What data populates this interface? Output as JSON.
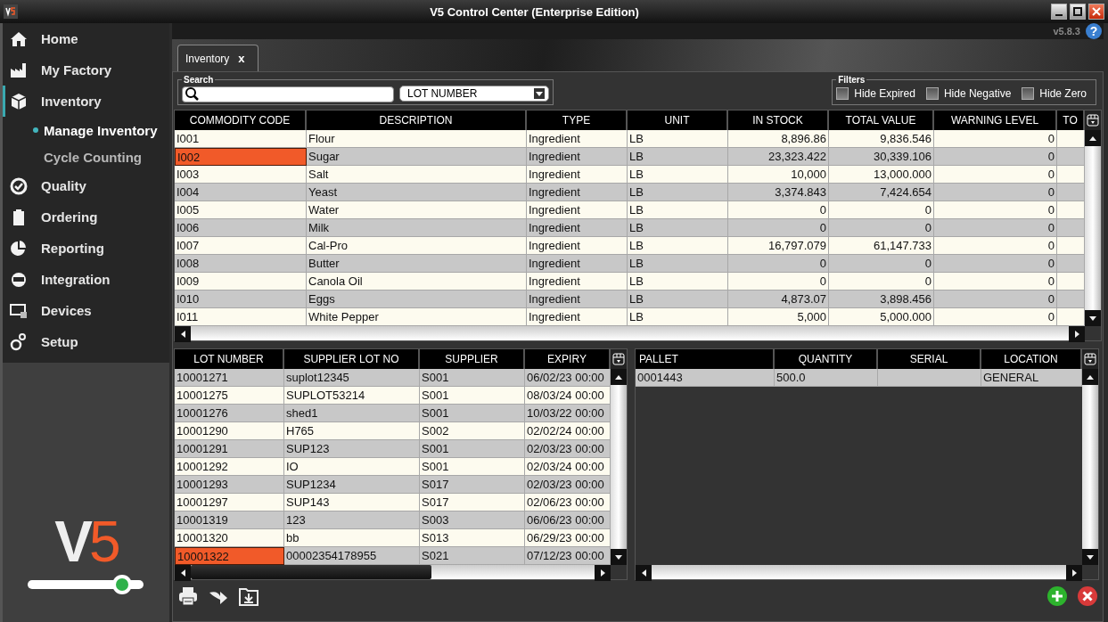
{
  "window": {
    "title": "V5 Control Center (Enterprise Edition)",
    "version": "v5.8.3",
    "help": "?"
  },
  "sidebar": {
    "items": [
      {
        "label": "Home",
        "selected": false
      },
      {
        "label": "My Factory",
        "selected": false
      },
      {
        "label": "Inventory",
        "selected": true,
        "children": [
          {
            "label": "Manage Inventory",
            "selected": true
          },
          {
            "label": "Cycle Counting",
            "selected": false
          }
        ]
      },
      {
        "label": "Quality",
        "selected": false
      },
      {
        "label": "Ordering",
        "selected": false
      },
      {
        "label": "Reporting",
        "selected": false
      },
      {
        "label": "Integration",
        "selected": false
      },
      {
        "label": "Devices",
        "selected": false
      },
      {
        "label": "Setup",
        "selected": false
      }
    ]
  },
  "logo": {
    "letter": "V",
    "digit": "5"
  },
  "tabs": [
    {
      "label": "Inventory",
      "close": "x",
      "selected": true
    }
  ],
  "search": {
    "label": "Search",
    "dropdown": "LOT NUMBER"
  },
  "filters": {
    "label": "Filters",
    "options": [
      {
        "label": "Hide Expired",
        "checked": false
      },
      {
        "label": "Hide Negative",
        "checked": false
      },
      {
        "label": "Hide Zero",
        "checked": false
      }
    ]
  },
  "inventory_table": {
    "columns": [
      "COMMODITY CODE",
      "DESCRIPTION",
      "TYPE",
      "UNIT",
      "IN STOCK",
      "TOTAL VALUE",
      "WARNING LEVEL",
      "TO"
    ],
    "rows": [
      {
        "cells": [
          "I001",
          "Flour",
          "Ingredient",
          "LB",
          "8,896.86",
          "9,836.546",
          "0"
        ],
        "selected": false
      },
      {
        "cells": [
          "I002",
          "Sugar",
          "Ingredient",
          "LB",
          "23,323.422",
          "30,339.106",
          "0"
        ],
        "selected": true
      },
      {
        "cells": [
          "I003",
          "Salt",
          "Ingredient",
          "LB",
          "10,000",
          "13,000.000",
          "0"
        ],
        "selected": false
      },
      {
        "cells": [
          "I004",
          "Yeast",
          "Ingredient",
          "LB",
          "3,374.843",
          "7,424.654",
          "0"
        ],
        "selected": false
      },
      {
        "cells": [
          "I005",
          "Water",
          "Ingredient",
          "LB",
          "0",
          "0",
          "0"
        ],
        "selected": false
      },
      {
        "cells": [
          "I006",
          "Milk",
          "Ingredient",
          "LB",
          "0",
          "0",
          "0"
        ],
        "selected": false
      },
      {
        "cells": [
          "I007",
          "Cal-Pro",
          "Ingredient",
          "LB",
          "16,797.079",
          "61,147.733",
          "0"
        ],
        "selected": false
      },
      {
        "cells": [
          "I008",
          "Butter",
          "Ingredient",
          "LB",
          "0",
          "0",
          "0"
        ],
        "selected": false
      },
      {
        "cells": [
          "I009",
          "Canola Oil",
          "Ingredient",
          "LB",
          "0",
          "0",
          "0"
        ],
        "selected": false
      },
      {
        "cells": [
          "I010",
          "Eggs",
          "Ingredient",
          "LB",
          "4,873.07",
          "3,898.456",
          "0"
        ],
        "selected": false
      },
      {
        "cells": [
          "I011",
          "White Pepper",
          "Ingredient",
          "LB",
          "5,000",
          "5,000.000",
          "0"
        ],
        "selected": false
      }
    ]
  },
  "lots_table": {
    "columns": [
      "LOT NUMBER",
      "SUPPLIER LOT NO",
      "SUPPLIER",
      "EXPIRY"
    ],
    "rows": [
      {
        "cells": [
          "10001271",
          "suplot12345",
          "S001",
          "06/02/23 00:00"
        ],
        "selected": false
      },
      {
        "cells": [
          "10001275",
          "SUPLOT53214",
          "S001",
          "08/03/24 00:00"
        ],
        "selected": false
      },
      {
        "cells": [
          "10001276",
          "shed1",
          "S001",
          "10/03/22 00:00"
        ],
        "selected": false
      },
      {
        "cells": [
          "10001290",
          "H765",
          "S002",
          "02/02/24 00:00"
        ],
        "selected": false
      },
      {
        "cells": [
          "10001291",
          "SUP123",
          "S001",
          "02/03/23 00:00"
        ],
        "selected": false
      },
      {
        "cells": [
          "10001292",
          "IO",
          "S001",
          "02/03/24 00:00"
        ],
        "selected": false
      },
      {
        "cells": [
          "10001293",
          "SUP1234",
          "S017",
          "02/03/23 00:00"
        ],
        "selected": false
      },
      {
        "cells": [
          "10001297",
          "SUP143",
          "S017",
          "02/06/23 00:00"
        ],
        "selected": false
      },
      {
        "cells": [
          "10001319",
          "123",
          "S003",
          "06/06/23 00:00"
        ],
        "selected": false
      },
      {
        "cells": [
          "10001320",
          "bb",
          "S013",
          "06/29/23 00:00"
        ],
        "selected": false
      },
      {
        "cells": [
          "10001322",
          "00002354178955",
          "S021",
          "07/12/23 00:00"
        ],
        "selected": true
      }
    ]
  },
  "pallets_table": {
    "columns": [
      "PALLET",
      "QUANTITY",
      "SERIAL",
      "LOCATION"
    ],
    "rows": [
      {
        "cells": [
          "0001443",
          "500.0",
          "",
          "GENERAL"
        ],
        "selected": false
      }
    ]
  }
}
